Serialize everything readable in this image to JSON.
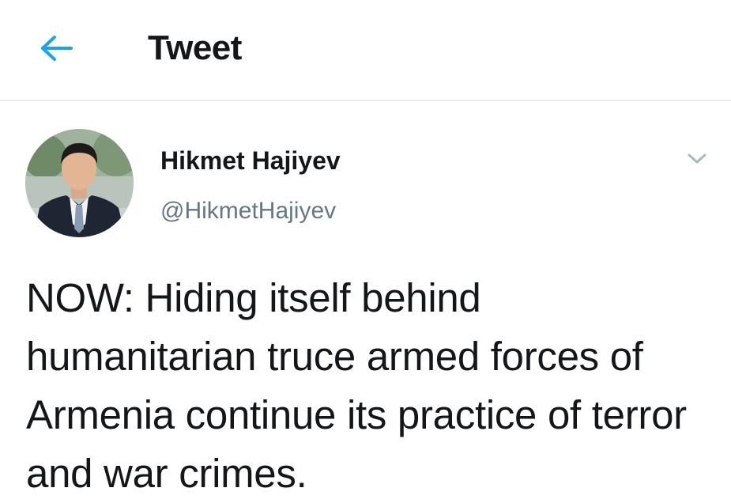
{
  "header": {
    "back_icon": "arrow-left-icon",
    "title": "Tweet",
    "accent_color": "#1da1f2"
  },
  "tweet": {
    "author": {
      "display_name": "Hikmet Hajiyev",
      "handle": "@HikmetHajiyev",
      "avatar_icon": "avatar-photo"
    },
    "more_icon": "chevron-down-icon",
    "text": "NOW: Hiding itself behind humanitarian truce armed forces of Armenia continue its practice of terror and war crimes."
  }
}
